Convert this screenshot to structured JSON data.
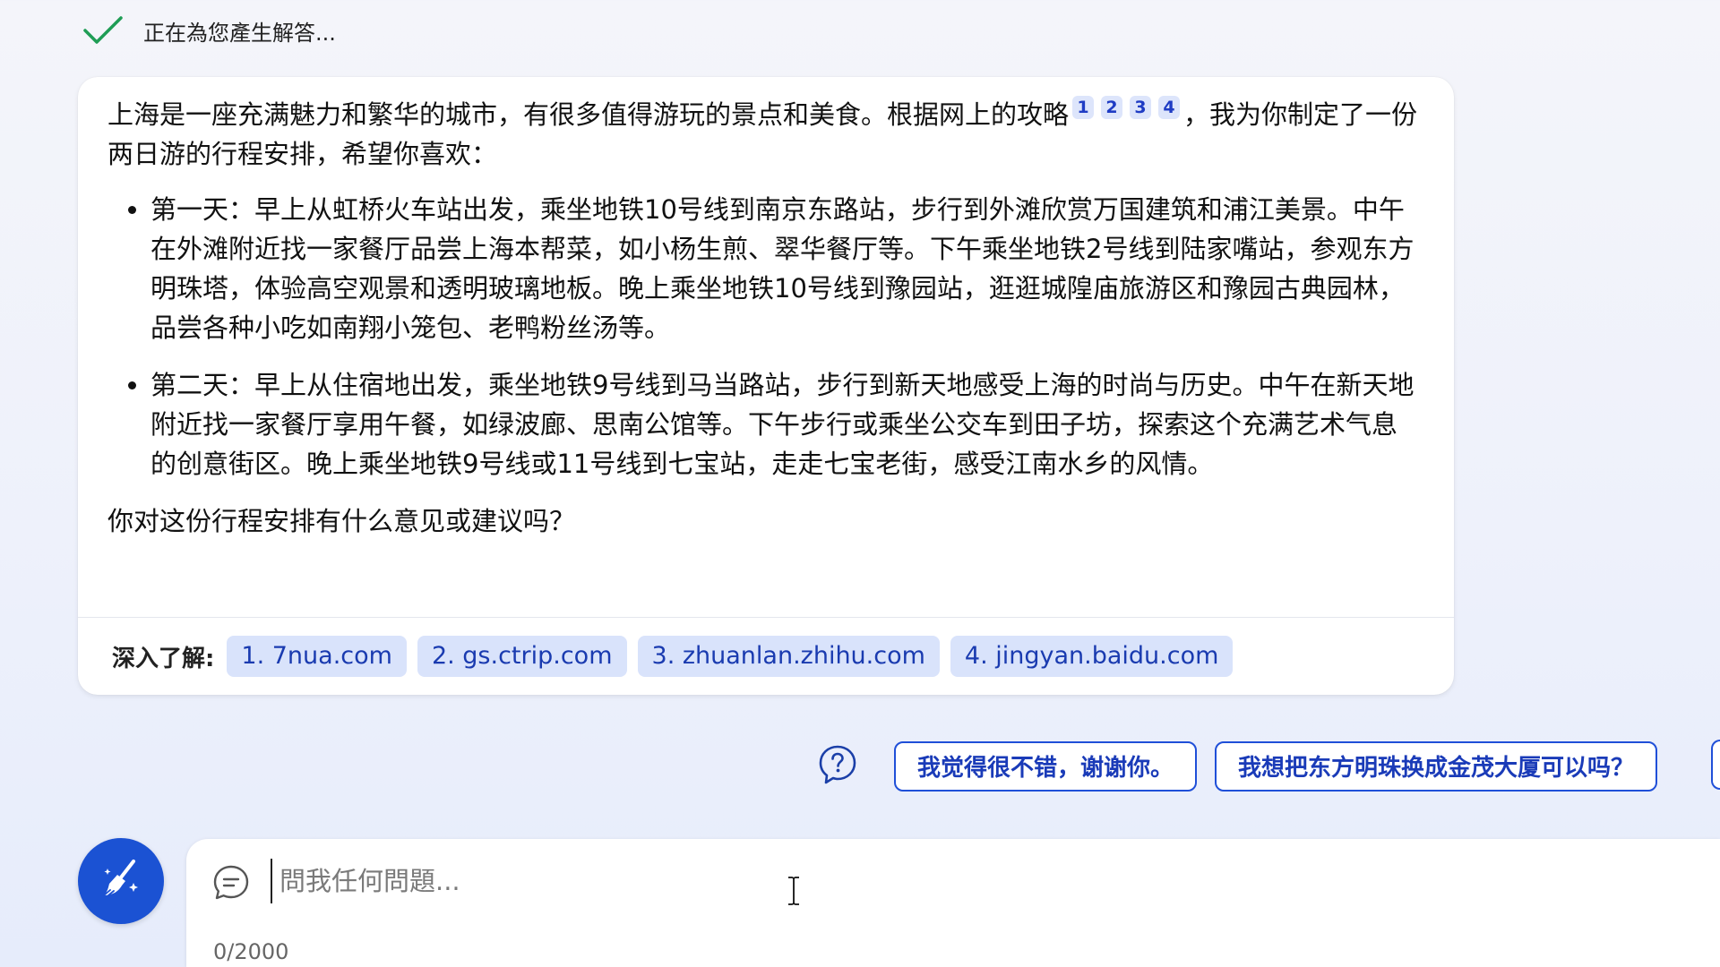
{
  "status": {
    "text": "正在為您產生解答..."
  },
  "response": {
    "intro_before_cites": "上海是一座充满魅力和繁华的城市，有很多值得游玩的景点和美食。根据网上的攻略",
    "citations": [
      "1",
      "2",
      "3",
      "4"
    ],
    "intro_after_cites": "，我为你制定了一份两日游的行程安排，希望你喜欢：",
    "items": [
      "第一天：早上从虹桥火车站出发，乘坐地铁10号线到南京东路站，步行到外滩欣赏万国建筑和浦江美景。中午在外滩附近找一家餐厅品尝上海本帮菜，如小杨生煎、翠华餐厅等。下午乘坐地铁2号线到陆家嘴站，参观东方明珠塔，体验高空观景和透明玻璃地板。晚上乘坐地铁10号线到豫园站，逛逛城隍庙旅游区和豫园古典园林，品尝各种小吃如南翔小笼包、老鸭粉丝汤等。",
      "第二天：早上从住宿地出发，乘坐地铁9号线到马当路站，步行到新天地感受上海的时尚与历史。中午在新天地附近找一家餐厅享用午餐，如绿波廊、思南公馆等。下午步行或乘坐公交车到田子坊，探索这个充满艺术气息的创意街区。晚上乘坐地铁9号线或11号线到七宝站，走走七宝老街，感受江南水乡的风情。"
    ],
    "closing": "你对这份行程安排有什么意见或建议吗？"
  },
  "learn_more": {
    "label": "深入了解:",
    "sources": [
      "1. 7nua.com",
      "2. gs.ctrip.com",
      "3. zhuanlan.zhihu.com",
      "4. jingyan.baidu.com"
    ]
  },
  "suggestions": [
    "我觉得很不错，谢谢你。",
    "我想把东方明珠换成金茂大厦可以吗？"
  ],
  "input": {
    "placeholder": "問我任何問題...",
    "value": "",
    "counter": "0/2000"
  },
  "colors": {
    "accent": "#1b52d3",
    "citation_bg": "#dde5fb",
    "status_check": "#1f9d55"
  },
  "icons": {
    "status": "checkmark-icon",
    "help": "question-bubble-icon",
    "new_topic": "broom-icon",
    "input": "chat-bubble-icon"
  }
}
